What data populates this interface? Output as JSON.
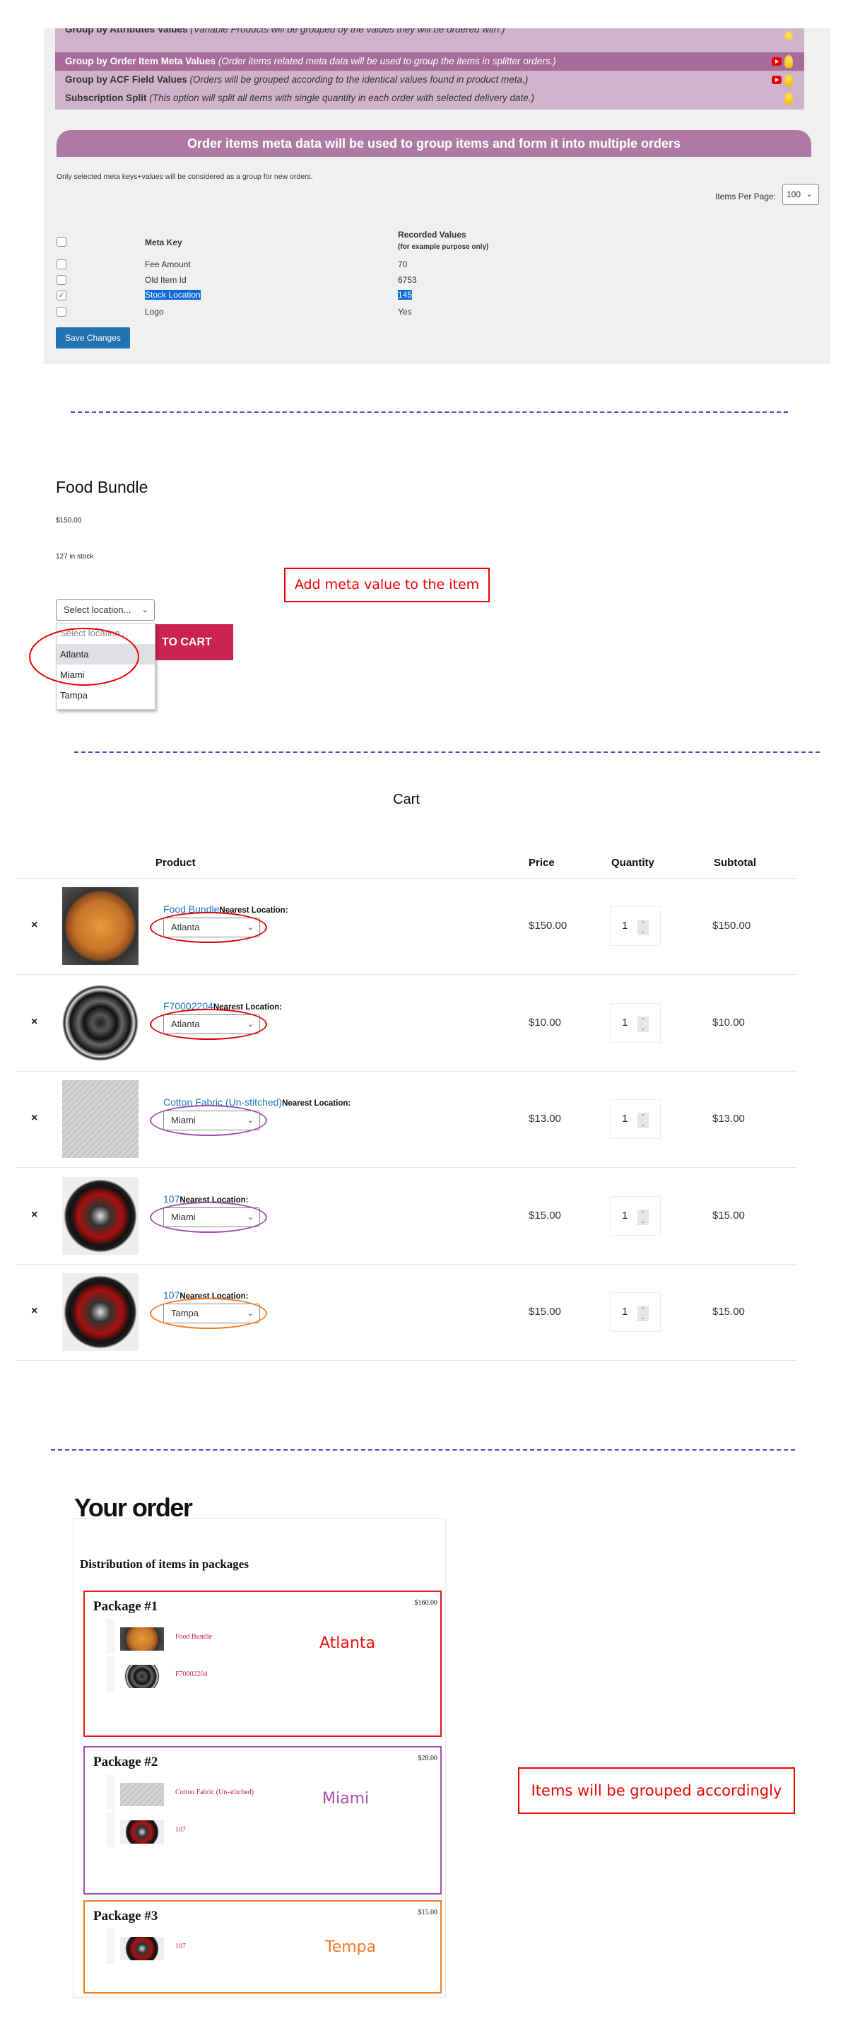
{
  "admin": {
    "options": [
      {
        "title": "Group by Attributes Values",
        "desc": "(Variable Products will be grouped by the values they will be ordered with.)",
        "video": false
      },
      {
        "title": "Group by Order Item Meta Values",
        "desc": "(Order items related meta data will be used to group the items in splitter orders.)",
        "video": true,
        "selected": true
      },
      {
        "title": "Group by ACF Field Values",
        "desc": "(Orders will be grouped according to the identical values found in product meta.)",
        "video": true
      },
      {
        "title": "Subscription Split",
        "desc": "(This option will split all items with single quantity in each order with selected delivery date.)",
        "video": false
      }
    ],
    "banner": "Order items meta data will be used to group items and form it into multiple orders",
    "note": "Only selected meta keys+values will be considered as a group for new orders.",
    "items_per_page_label": "Items Per Page:",
    "items_per_page": "100",
    "table": {
      "col_key": "Meta Key",
      "col_values": "Recorded Values",
      "col_values_note": "(for example purpose only)",
      "rows": [
        {
          "key": "Fee Amount",
          "value": "70",
          "checked": false
        },
        {
          "key": "Old Item Id",
          "value": "6753",
          "checked": false
        },
        {
          "key": "Stock Location",
          "value": "145",
          "checked": true
        },
        {
          "key": "Logo",
          "value": "Yes",
          "checked": false
        }
      ]
    },
    "save": "Save Changes",
    "colors": {
      "options_bg": "#cfb3cb",
      "selected_bg": "#a66d99",
      "banner_bg": "#ae7aa3",
      "button": "#2271b1"
    }
  },
  "product": {
    "title": "Food Bundle",
    "price": "$150.00",
    "stock": "127 in stock",
    "select_placeholder": "Select location...",
    "options": [
      "Select location...",
      "Atlanta",
      "Miami",
      "Tampa"
    ],
    "add_to_cart": "TO CART",
    "callout": "Add meta value to the item"
  },
  "cart": {
    "title": "Cart",
    "headers": {
      "product": "Product",
      "price": "Price",
      "quantity": "Quantity",
      "subtotal": "Subtotal"
    },
    "location_label": "Nearest Location:",
    "remove": "×",
    "rows": [
      {
        "name": "Food Bundle",
        "location": "Atlanta",
        "price": "$150.00",
        "qty": "1",
        "subtotal": "$150.00",
        "image": "pizza",
        "ring": "#e00000"
      },
      {
        "name": "F70002204",
        "location": "Atlanta",
        "price": "$10.00",
        "qty": "1",
        "subtotal": "$10.00",
        "image": "wheel-spoke",
        "ring": "#e00000"
      },
      {
        "name": "Cotton Fabric (Un-stitched)",
        "location": "Miami",
        "price": "$13.00",
        "qty": "1",
        "subtotal": "$13.00",
        "image": "fabric",
        "ring": "#a64db0"
      },
      {
        "name": "107",
        "location": "Miami",
        "price": "$15.00",
        "qty": "1",
        "subtotal": "$15.00",
        "image": "wheel-red",
        "ring": "#a64db0"
      },
      {
        "name": "107",
        "location": "Tampa",
        "price": "$15.00",
        "qty": "1",
        "subtotal": "$15.00",
        "image": "wheel-red",
        "ring": "#f47c20"
      }
    ]
  },
  "order": {
    "title": "Your order",
    "dist_title": "Distribution of items in packages",
    "packages": [
      {
        "name": "Package #1",
        "total": "$160.00",
        "label": "Atlanta",
        "color": "#ee1111",
        "items": [
          "Food Bundle",
          "F70002204"
        ]
      },
      {
        "name": "Package #2",
        "total": "$28.00",
        "label": "Miami",
        "color": "#a64db0",
        "items": [
          "Cotton Fabric (Un-stitched)",
          "107"
        ]
      },
      {
        "name": "Package #3",
        "total": "$15.00",
        "label": "Tempa",
        "color": "#f47c20",
        "items": [
          "107"
        ]
      }
    ],
    "callout": "Items will be grouped accordingly"
  }
}
